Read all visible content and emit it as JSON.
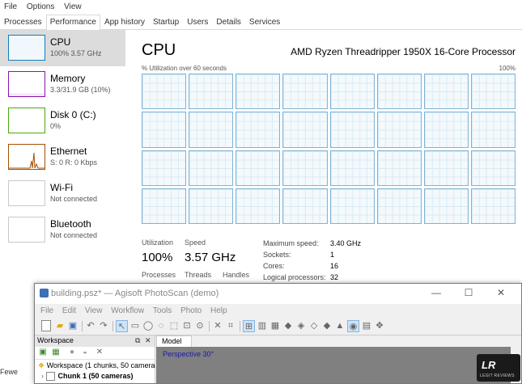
{
  "task_manager": {
    "menu": [
      "File",
      "Options",
      "View"
    ],
    "tabs": [
      "Processes",
      "Performance",
      "App history",
      "Startup",
      "Users",
      "Details",
      "Services"
    ],
    "active_tab": "Performance",
    "sidebar": [
      {
        "name": "CPU",
        "sub": "100% 3.57 GHz",
        "color": "#117dbb",
        "active": true
      },
      {
        "name": "Memory",
        "sub": "3.3/31.9 GB (10%)",
        "color": "#8b12ae"
      },
      {
        "name": "Disk 0 (C:)",
        "sub": "0%",
        "color": "#4da60c"
      },
      {
        "name": "Ethernet",
        "sub": "S: 0 R: 0 Kbps",
        "color": "#a74f01"
      },
      {
        "name": "Wi-Fi",
        "sub": "Not connected",
        "color": "#c8c8c8"
      },
      {
        "name": "Bluetooth",
        "sub": "Not connected",
        "color": "#c8c8c8"
      }
    ],
    "title": "CPU",
    "processor": "AMD Ryzen Threadripper 1950X 16-Core Processor",
    "util_label": "% Utilization over 60 seconds",
    "util_max": "100%",
    "core_count": 32,
    "stats": {
      "utilization_label": "Utilization",
      "utilization": "100%",
      "speed_label": "Speed",
      "speed": "3.57 GHz",
      "processes_label": "Processes",
      "threads_label": "Threads",
      "handles_label": "Handles"
    },
    "specs": [
      {
        "label": "Maximum speed:",
        "value": "3.40 GHz"
      },
      {
        "label": "Sockets:",
        "value": "1"
      },
      {
        "label": "Cores:",
        "value": "16"
      },
      {
        "label": "Logical processors:",
        "value": "32"
      }
    ]
  },
  "photoscan": {
    "title": "building.psz* — Agisoft PhotoScan (demo)",
    "window_buttons": {
      "minimize": "—",
      "maximize": "☐",
      "close": "✕"
    },
    "menu": [
      "File",
      "Edit",
      "View",
      "Workflow",
      "Tools",
      "Photo",
      "Help"
    ],
    "workspace": {
      "header": "Workspace",
      "pin": "⧉",
      "close": "✕",
      "root": "Workspace (1 chunks, 50 camera",
      "chunk": "Chunk 1 (50 cameras)"
    },
    "model_tab": "Model",
    "viewport_label": "Perspective 30°"
  },
  "background": {
    "partial_text": "Fewe"
  }
}
